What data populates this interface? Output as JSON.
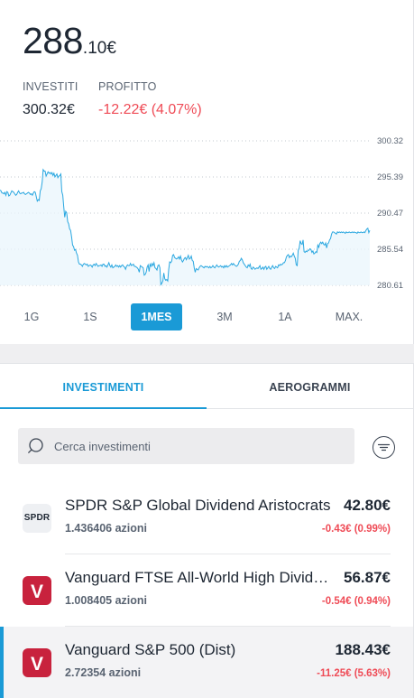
{
  "summary": {
    "balance_int": "288",
    "balance_dec": ".10€",
    "invested_label": "INVESTITI",
    "invested_value": "300.32€",
    "profit_label": "PROFITTO",
    "profit_value": "-12.22€ (4.07%)",
    "colors": {
      "loss": "#ef4b56",
      "accent": "#1a9ad6"
    }
  },
  "chart_data": {
    "type": "area",
    "ylim": [
      280.61,
      300.32
    ],
    "yticks": [
      "300.32",
      "295.39",
      "290.47",
      "285.54",
      "280.61"
    ],
    "y": [
      293.6,
      293.5,
      293.2,
      293.2,
      293.1,
      293.3,
      292.9,
      293.4,
      293.3,
      292.8,
      292.9,
      293.2,
      293.5,
      293.4,
      293.3,
      293.1,
      292.9,
      293.0,
      293.3,
      293.5,
      293.2,
      293.1,
      293.2,
      293.2,
      293.3,
      293.1,
      293.0,
      293.1,
      293.2,
      293.3,
      293.2,
      293.0,
      293.1,
      292.9,
      293.2,
      293.4,
      293.3,
      292.7,
      292.1,
      292.3,
      292.2,
      293.5,
      293.8,
      294.7,
      296.4,
      296.2,
      296.2,
      295.5,
      295.8,
      296.1,
      295.9,
      296.0,
      295.8,
      296.0,
      295.6,
      295.9,
      295.4,
      295.6,
      295.8,
      295.3,
      295.5,
      295.6,
      295.8,
      293.4,
      292.9,
      291.3,
      289.9,
      290.7,
      290.5,
      289.3,
      289.0,
      288.3,
      288.1,
      287.2,
      286.1,
      285.9,
      285.4,
      285.5,
      285.0,
      284.7,
      283.8,
      283.5,
      283.5,
      283.4,
      283.2,
      283.5,
      283.6,
      283.5,
      283.4,
      283.5,
      283.2,
      283.3,
      283.4,
      283.3,
      283.1,
      283.4,
      283.5,
      283.3,
      283.6,
      283.4,
      283.2,
      283.3,
      283.3,
      283.4,
      283.2,
      283.5,
      283.5,
      283.2,
      283.3,
      283.1,
      283.4,
      283.7,
      283.3,
      283.1,
      283.4,
      283.0,
      283.1,
      283.2,
      283.4,
      283.2,
      283.3,
      283.1,
      283.3,
      283.1,
      283.3,
      283.4,
      283.2,
      283.1,
      282.8,
      283.2,
      283.4,
      283.3,
      283.3,
      283.6,
      283.3,
      283.4,
      283.5,
      283.2,
      283.2,
      283.1,
      283.0,
      282.8,
      282.4,
      283.3,
      283.2,
      283.1,
      283.0,
      282.0,
      282.1,
      282.4,
      283.1,
      283.4,
      282.5,
      283.5,
      283.2,
      283.6,
      283.3,
      283.7,
      283.0,
      282.9,
      282.7,
      283.3,
      283.4,
      283.0,
      280.7,
      280.9,
      281.2,
      282.3,
      281.5,
      281.3,
      281.4,
      281.2,
      282.8,
      283.8,
      283.7,
      283.9,
      284.7,
      284.8,
      284.4,
      284.3,
      284.2,
      284.3,
      284.5,
      284.2,
      284.6,
      284.1,
      283.8,
      284.0,
      284.3,
      284.4,
      284.1,
      284.4,
      284.7,
      284.2,
      284.3,
      284.6,
      284.0,
      283.9,
      283.0,
      282.4,
      282.9,
      282.8,
      282.7,
      283.0,
      283.2,
      283.3,
      283.2,
      283.1,
      283.0,
      283.2,
      283.1,
      283.2,
      283.1,
      283.0,
      283.2,
      283.0,
      283.1,
      283.3,
      283.1,
      283.0,
      283.2,
      283.4,
      283.2,
      283.1,
      283.2,
      283.3,
      283.1,
      283.2,
      283.0,
      283.3,
      283.1,
      283.3,
      283.1,
      283.2,
      283.3,
      283.4,
      283.6,
      283.4,
      283.6,
      283.4,
      283.3,
      283.2,
      283.3,
      283.5,
      283.9,
      284.0,
      284.3,
      284.1,
      283.7,
      283.5,
      283.3,
      283.1,
      283.0,
      283.4,
      283.2,
      283.5,
      282.9,
      282.8,
      283.1,
      283.0,
      282.8,
      282.9,
      283.0,
      282.9,
      283.1,
      283.3,
      282.8,
      282.9,
      283.1,
      282.8,
      283.1,
      283.2,
      282.8,
      283.0,
      283.2,
      282.9,
      282.8,
      283.1,
      283.3,
      283.0,
      282.9,
      283.2,
      283.1,
      283.0,
      283.4,
      283.3,
      283.5,
      283.4,
      283.5,
      283.7,
      283.7,
      284.0,
      284.5,
      284.7,
      284.8,
      284.4,
      284.6,
      284.5,
      284.7,
      285.0,
      284.6,
      284.3,
      283.4,
      283.3,
      285.4,
      285.7,
      286.7,
      286.3,
      286.2,
      286.8,
      285.2,
      285.1,
      285.3,
      285.2,
      285.4,
      285.4,
      285.6,
      285.5,
      285.1,
      285.3,
      284.9,
      285.0,
      285.2,
      285.1,
      286.1,
      285.8,
      286.3,
      286.5,
      286.3,
      286.5,
      286.2,
      286.1,
      286.4,
      285.7,
      286.3,
      286.4,
      286.8,
      287.0,
      287.6,
      287.9,
      287.9,
      287.8,
      287.7,
      287.6,
      287.9,
      287.8,
      287.9,
      287.8,
      287.9,
      287.8,
      287.9,
      287.8,
      287.7,
      287.9,
      287.8,
      287.8,
      287.9,
      287.8,
      287.8,
      287.9,
      287.8,
      287.9,
      287.8,
      287.8,
      287.7,
      287.9,
      287.8,
      287.8,
      287.9,
      287.8,
      287.8,
      287.9,
      287.8,
      288.1,
      288.3,
      288.4,
      287.8,
      288.1
    ]
  },
  "ranges": [
    "1G",
    "1S",
    "1MES",
    "3M",
    "1A",
    "MAX."
  ],
  "active_range": "1MES",
  "tabs": {
    "investments": "INVESTIMENTI",
    "aerograms": "AEROGRAMMI"
  },
  "search": {
    "placeholder": "Cerca investimenti",
    "icon": "search-icon"
  },
  "filter_icon": "filter-icon",
  "holdings": [
    {
      "logo": "SPDR",
      "name": "SPDR S&P Global Dividend Aristocrats",
      "shares": "1.436406 azioni",
      "value": "42.80€",
      "change": "-0.43€ (0.99%)"
    },
    {
      "logo": "V",
      "name": "Vanguard FTSE All-World High Dividend Yield",
      "shares": "1.008405 azioni",
      "value": "56.87€",
      "change": "-0.54€ (0.94%)"
    },
    {
      "logo": "V",
      "name": "Vanguard S&P 500 (Dist)",
      "shares": "2.72354 azioni",
      "value": "188.43€",
      "change": "-11.25€ (5.63%)"
    }
  ]
}
